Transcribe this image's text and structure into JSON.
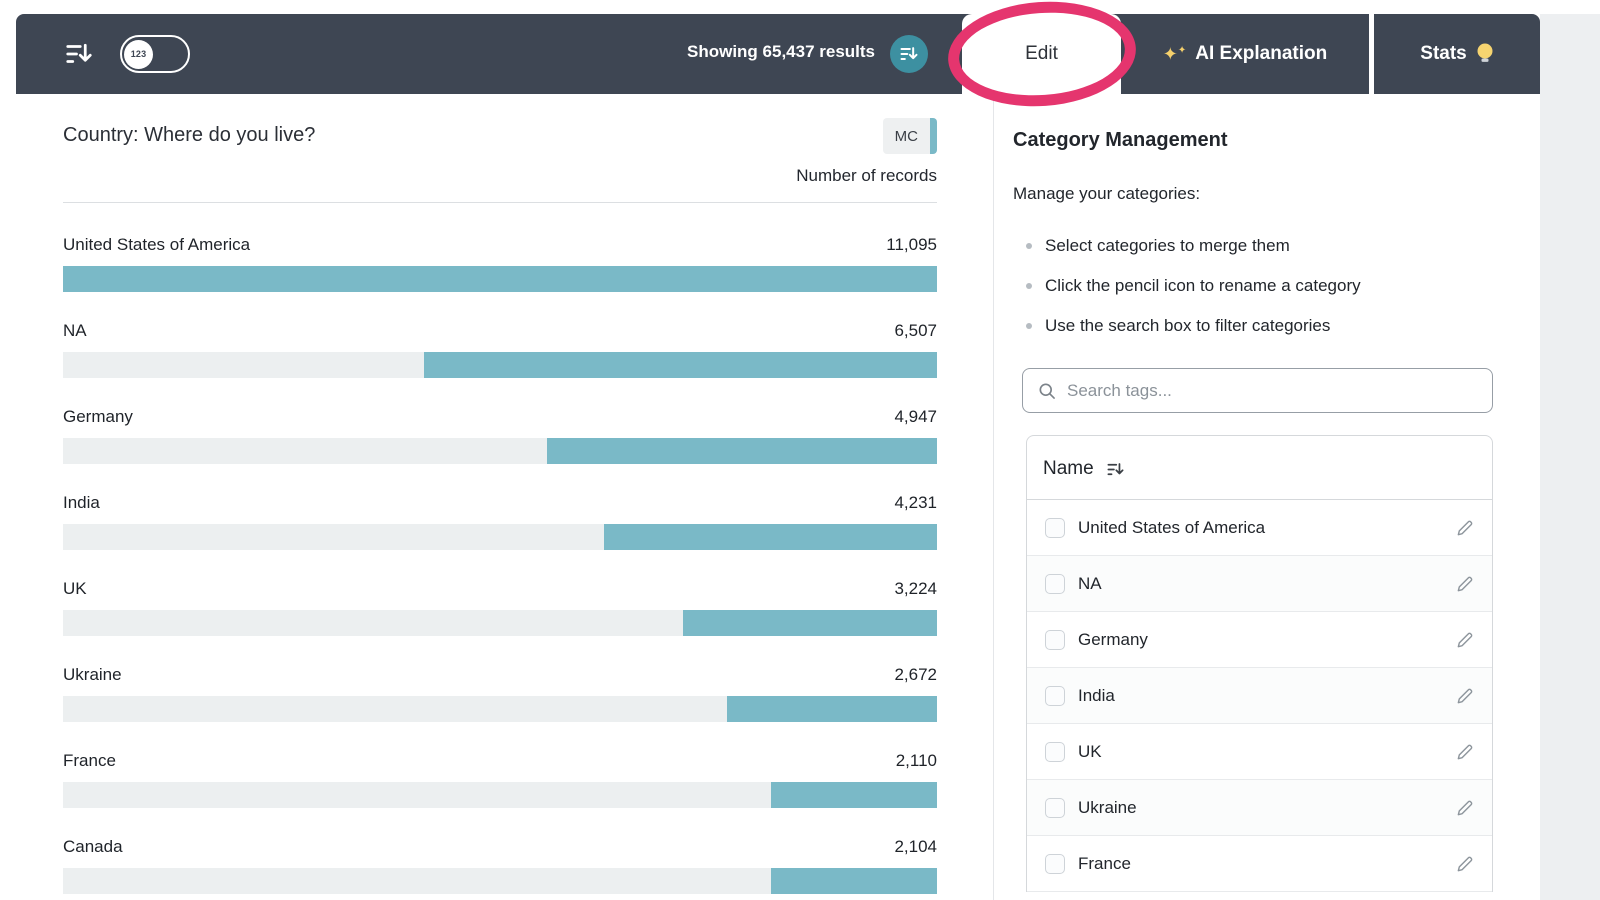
{
  "toolbar": {
    "results_text": "Showing 65,437 results",
    "numeric_badge": "123",
    "tabs": {
      "edit": "Edit",
      "ai": "AI Explanation",
      "stats": "Stats"
    }
  },
  "chart": {
    "title": "Country: Where do you live?",
    "type_badge": "MC",
    "column_header": "Number of records",
    "rows": [
      {
        "label": "United States of America",
        "value": "11,095"
      },
      {
        "label": "NA",
        "value": "6,507"
      },
      {
        "label": "Germany",
        "value": "4,947"
      },
      {
        "label": "India",
        "value": "4,231"
      },
      {
        "label": "UK",
        "value": "3,224"
      },
      {
        "label": "Ukraine",
        "value": "2,672"
      },
      {
        "label": "France",
        "value": "2,110"
      },
      {
        "label": "Canada",
        "value": "2,104"
      }
    ]
  },
  "chart_data": {
    "type": "bar",
    "orientation": "horizontal",
    "title": "Country: Where do you live?",
    "xlabel": "Number of records",
    "categories": [
      "United States of America",
      "NA",
      "Germany",
      "India",
      "UK",
      "Ukraine",
      "France",
      "Canada"
    ],
    "values": [
      11095,
      6507,
      4947,
      4231,
      3224,
      2672,
      2110,
      2104
    ],
    "xlim": [
      0,
      11095
    ],
    "bar_color": "#7ab9c7",
    "track_color": "#eceff0",
    "bar_alignment": "right",
    "total_results": 65437
  },
  "panel": {
    "title": "Category Management",
    "intro": "Manage your categories:",
    "bullets": [
      "Select categories to merge them",
      "Click the pencil icon to rename a category",
      "Use the search box to filter categories"
    ],
    "search_placeholder": "Search tags...",
    "table": {
      "name_header": "Name",
      "items": [
        "United States of America",
        "NA",
        "Germany",
        "India",
        "UK",
        "Ukraine",
        "France"
      ]
    }
  },
  "colors": {
    "toolbar_bg": "#3e4653",
    "accent_teal": "#7ab9c7",
    "teal_button": "#3d90a1",
    "annotation": "#e5356e"
  }
}
